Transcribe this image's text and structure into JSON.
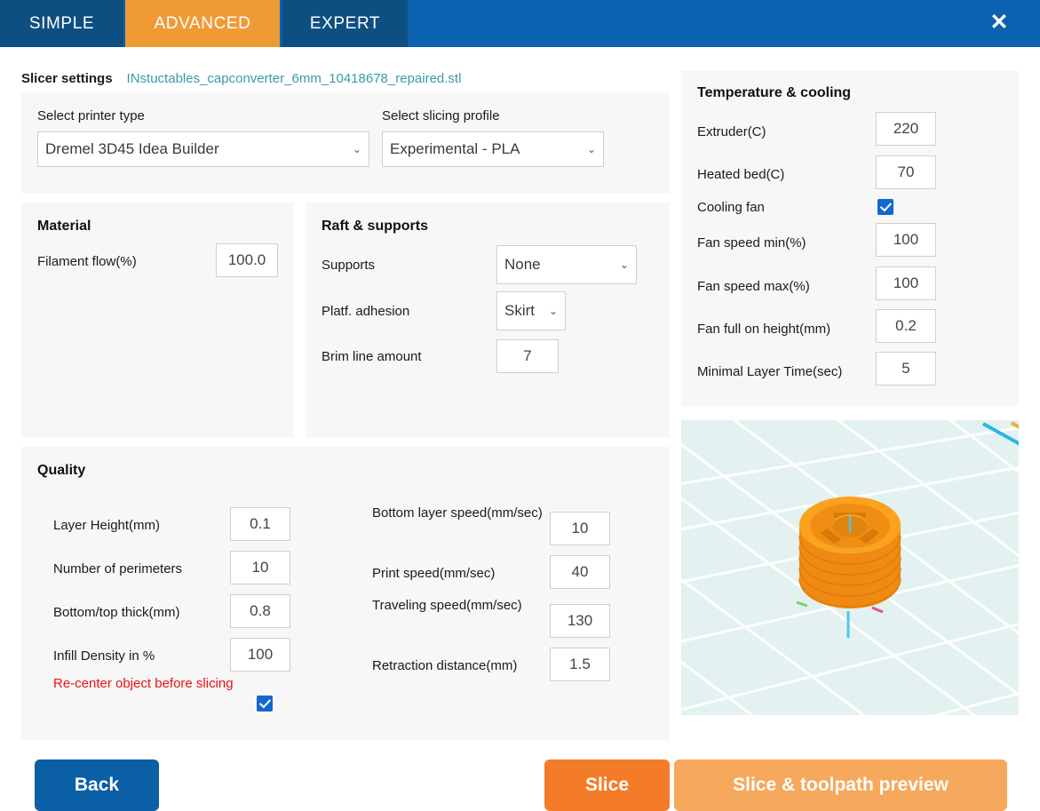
{
  "tabs": [
    {
      "label": "SIMPLE",
      "active": false
    },
    {
      "label": "ADVANCED",
      "active": true
    },
    {
      "label": "EXPERT",
      "active": false
    }
  ],
  "window": {
    "close_icon": "✕"
  },
  "header": {
    "title": "Slicer settings",
    "filename": "INstuctables_capconverter_6mm_10418678_repaired.stl",
    "filename_color": "#389CA8"
  },
  "top_settings": {
    "printer_label": "Select printer type",
    "printer_value": "Dremel 3D45 Idea Builder",
    "profile_label": "Select slicing profile",
    "profile_value": "Experimental - PLA",
    "caret": "⌄"
  },
  "material": {
    "title": "Material",
    "fields": [
      {
        "label": "Filament flow(%)",
        "value": "100.0"
      }
    ]
  },
  "raft": {
    "title": "Raft & supports",
    "supports_label": "Supports",
    "supports_value": "None",
    "adhesion_label": "Platf. adhesion",
    "adhesion_value": "Skirt",
    "brim_label": "Brim line amount",
    "brim_value": "7"
  },
  "quality": {
    "title": "Quality",
    "left_fields": [
      {
        "label": "Layer Height(mm)",
        "value": "0.1"
      },
      {
        "label": "Number of perimeters",
        "value": "10"
      },
      {
        "label": "Bottom/top thick(mm)",
        "value": "0.8"
      },
      {
        "label": "Infill Density in %",
        "value": "100"
      }
    ],
    "right_fields": [
      {
        "label": "Bottom layer speed(mm/sec)",
        "value": "10"
      },
      {
        "label": "Print speed(mm/sec)",
        "value": "40"
      },
      {
        "label": "Traveling speed(mm/sec)",
        "value": "130"
      },
      {
        "label": "Retraction distance(mm)",
        "value": "1.5"
      }
    ],
    "recenter_label": "Re-center object before slicing",
    "recenter_checked": true,
    "recenter_color": "#ee1111"
  },
  "temperature": {
    "title": "Temperature & cooling",
    "extruder_label": "Extruder(C)",
    "extruder_value": "220",
    "bed_label": "Heated bed(C)",
    "bed_value": "70",
    "fan_label": "Cooling fan",
    "fan_checked": true,
    "fan_min_label": "Fan speed min(%)",
    "fan_min_value": "100",
    "fan_max_label": "Fan speed max(%)",
    "fan_max_value": "100",
    "fan_height_label": "Fan full on height(mm)",
    "fan_height_value": "0.2",
    "min_layer_label": "Minimal Layer Time(sec)",
    "min_layer_value": "5"
  },
  "preview": {
    "model_color": "#F99B1C",
    "bed_color": "#E3F2F0",
    "grid_color": "#FFFFFF",
    "axis_z_color": "#4FC3F7",
    "axis_x_color": "#E8537A",
    "axis_y_color": "#6FD36F"
  },
  "footer": {
    "back_label": "Back",
    "slice_label": "Slice",
    "slice_preview_label": "Slice & toolpath preview",
    "back_color": "#0B5FA5",
    "slice_color": "#F47C28",
    "slice_preview_color": "#F6A85C"
  }
}
